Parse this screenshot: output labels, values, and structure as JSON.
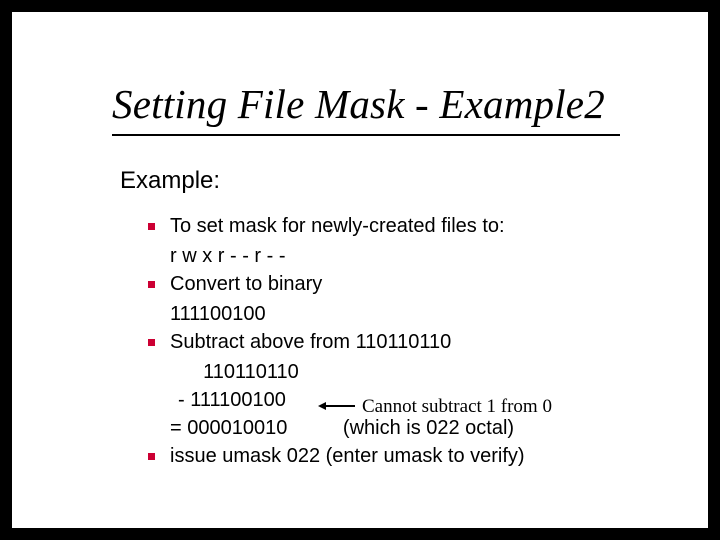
{
  "title": "Setting File Mask - Example2",
  "subhead": "Example:",
  "items": [
    {
      "text": "To set mask for newly-created files to:",
      "sub": [
        "r w x r - - r - -"
      ]
    },
    {
      "text": "Convert to binary",
      "sub": [
        "111100100"
      ]
    },
    {
      "text": "Subtract above from 110110110",
      "calc": [
        "  110110110",
        "- 111100100"
      ],
      "eq": "= 000010010          (which is 022 octal)"
    },
    {
      "text": "issue umask 022     (enter umask to verify)"
    }
  ],
  "annotation": "Cannot subtract 1 from 0"
}
